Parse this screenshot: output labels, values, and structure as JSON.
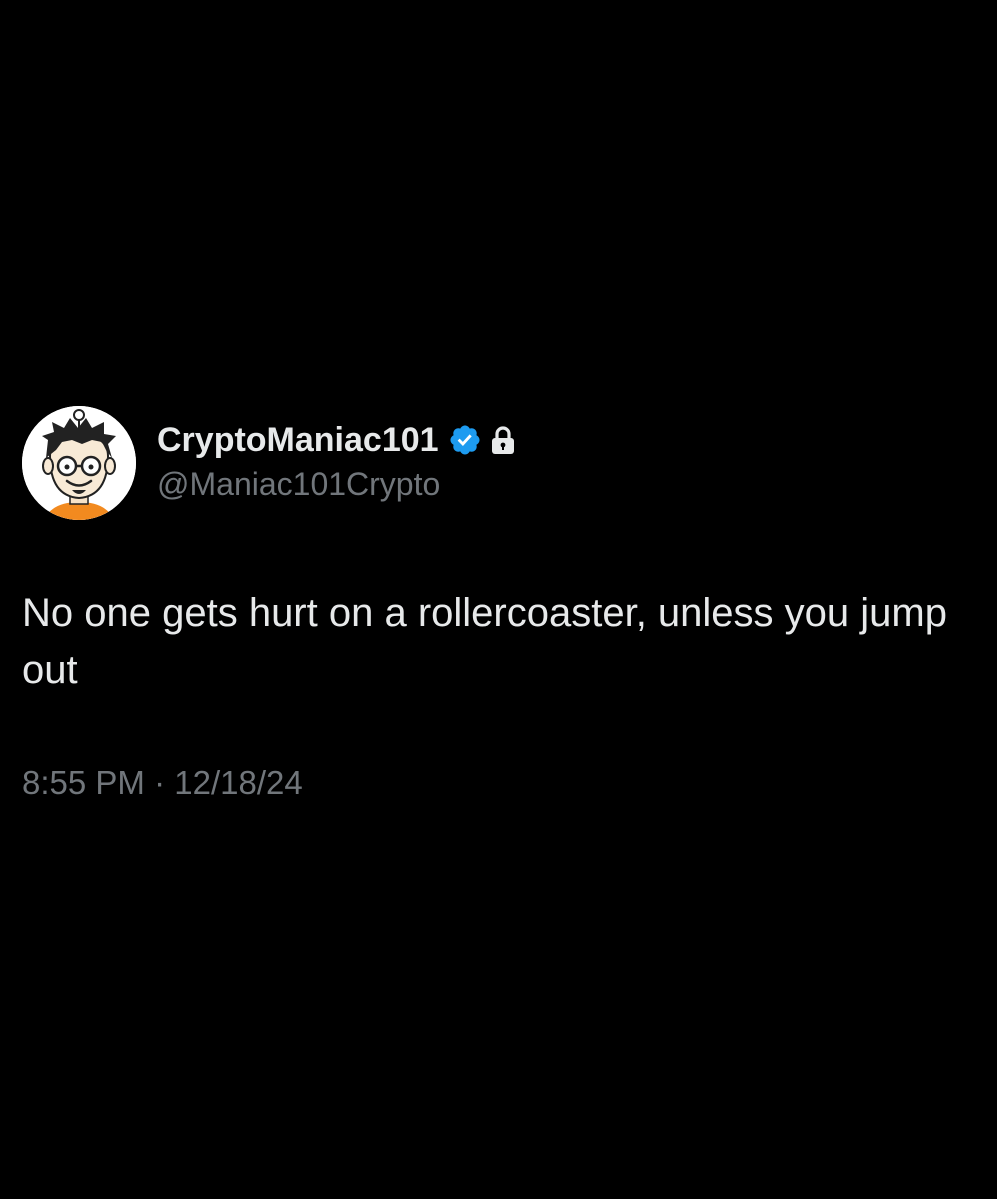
{
  "tweet": {
    "display_name": "CryptoManiac101",
    "handle": "@Maniac101Crypto",
    "text": "No one gets hurt on a rollercoaster, unless you jump out",
    "time": "8:55 PM",
    "separator": " · ",
    "date": "12/18/24"
  },
  "icons": {
    "verified": "verified-badge-icon",
    "lock": "lock-icon",
    "avatar": "cartoon-man-with-glasses-avatar"
  },
  "colors": {
    "background": "#000000",
    "primary_text": "#e7e9ea",
    "secondary_text": "#71767b",
    "verified_blue": "#1d9bf0",
    "avatar_shirt": "#f28a1f"
  }
}
